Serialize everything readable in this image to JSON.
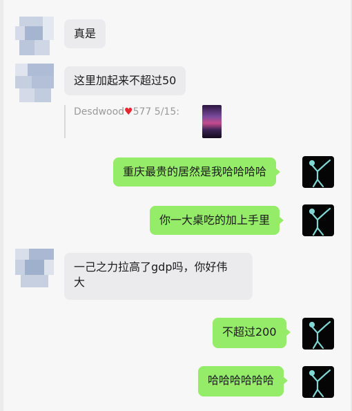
{
  "messages": [
    {
      "side": "left",
      "text": "真是"
    },
    {
      "side": "left",
      "text": "这里加起来不超过50"
    },
    {
      "side": "quote",
      "prefix": "Desdwood",
      "heart": "♥",
      "suffix": "577 5/15:"
    },
    {
      "side": "right",
      "text": "重庆最贵的居然是我哈哈哈哈"
    },
    {
      "side": "right",
      "text": "你一大桌吃的加上手里"
    },
    {
      "side": "left",
      "line1": "一己之力拉高了gdp吗，你好伟",
      "line2": "大"
    },
    {
      "side": "right",
      "text": "不超过200"
    },
    {
      "side": "right",
      "text": "哈哈哈哈哈哈"
    }
  ],
  "colors": {
    "bubble_left": "#ebebed",
    "bubble_right": "#95ec69",
    "heart": "#e8262f"
  },
  "icons": {
    "left_avatar": "pixelated-avatar",
    "right_avatar": "xray-figure-avatar"
  }
}
